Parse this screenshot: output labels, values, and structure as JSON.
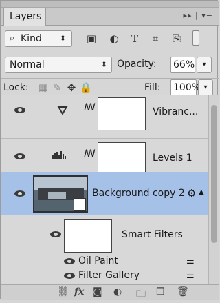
{
  "panel": {
    "tab_label": "Layers"
  },
  "filter": {
    "kind_label": "Kind"
  },
  "blend": {
    "mode": "Normal",
    "opacity_label": "Opacity:",
    "opacity_value": "66%"
  },
  "lock": {
    "label": "Lock:",
    "fill_label": "Fill:",
    "fill_value": "100%"
  },
  "layers": [
    {
      "name": "Vibranc..."
    },
    {
      "name": "Levels 1"
    },
    {
      "name": "Background copy 2"
    }
  ],
  "smart_filters": {
    "label": "Smart Filters",
    "items": [
      "Oil Paint",
      "Filter Gallery"
    ]
  }
}
